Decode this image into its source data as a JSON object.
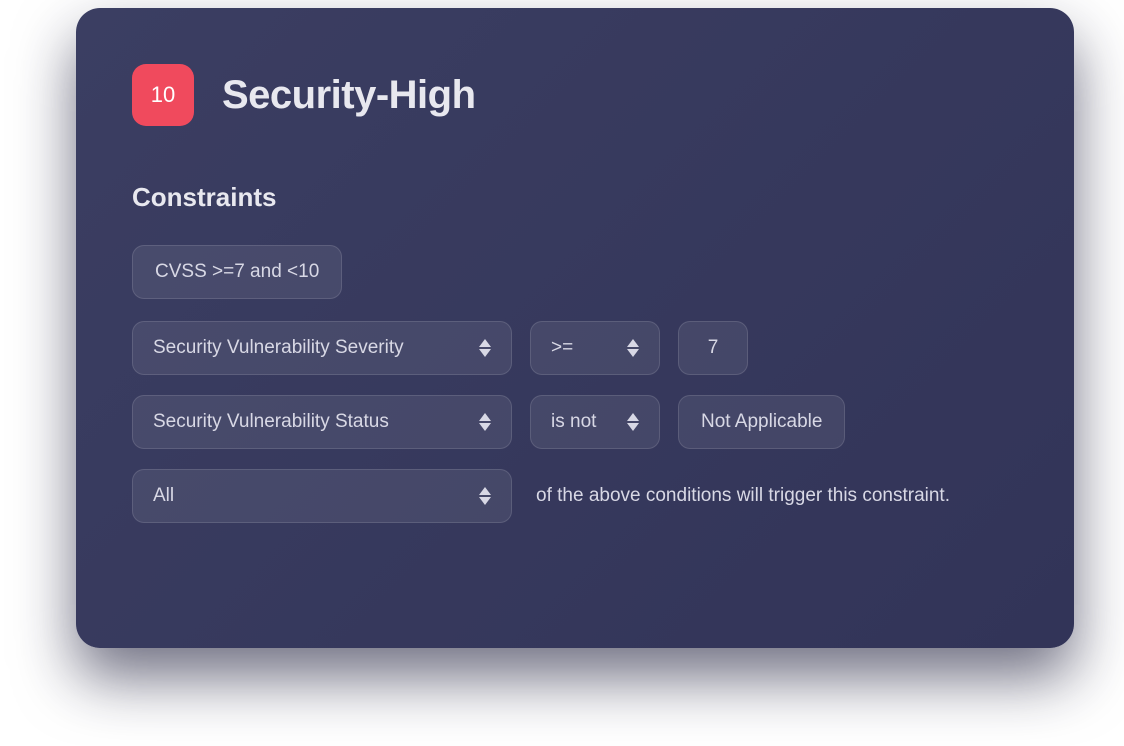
{
  "header": {
    "badge_number": "10",
    "title": "Security-High"
  },
  "section": {
    "title": "Constraints"
  },
  "tag": {
    "label": "CVSS >=7 and <10"
  },
  "rule1": {
    "field": "Security Vulnerability Severity",
    "operator": ">=",
    "value": "7"
  },
  "rule2": {
    "field": "Security Vulnerability Status",
    "operator": "is not",
    "value": "Not Applicable"
  },
  "logic": {
    "mode": "All",
    "trailing": "of the above conditions will trigger this constraint."
  }
}
